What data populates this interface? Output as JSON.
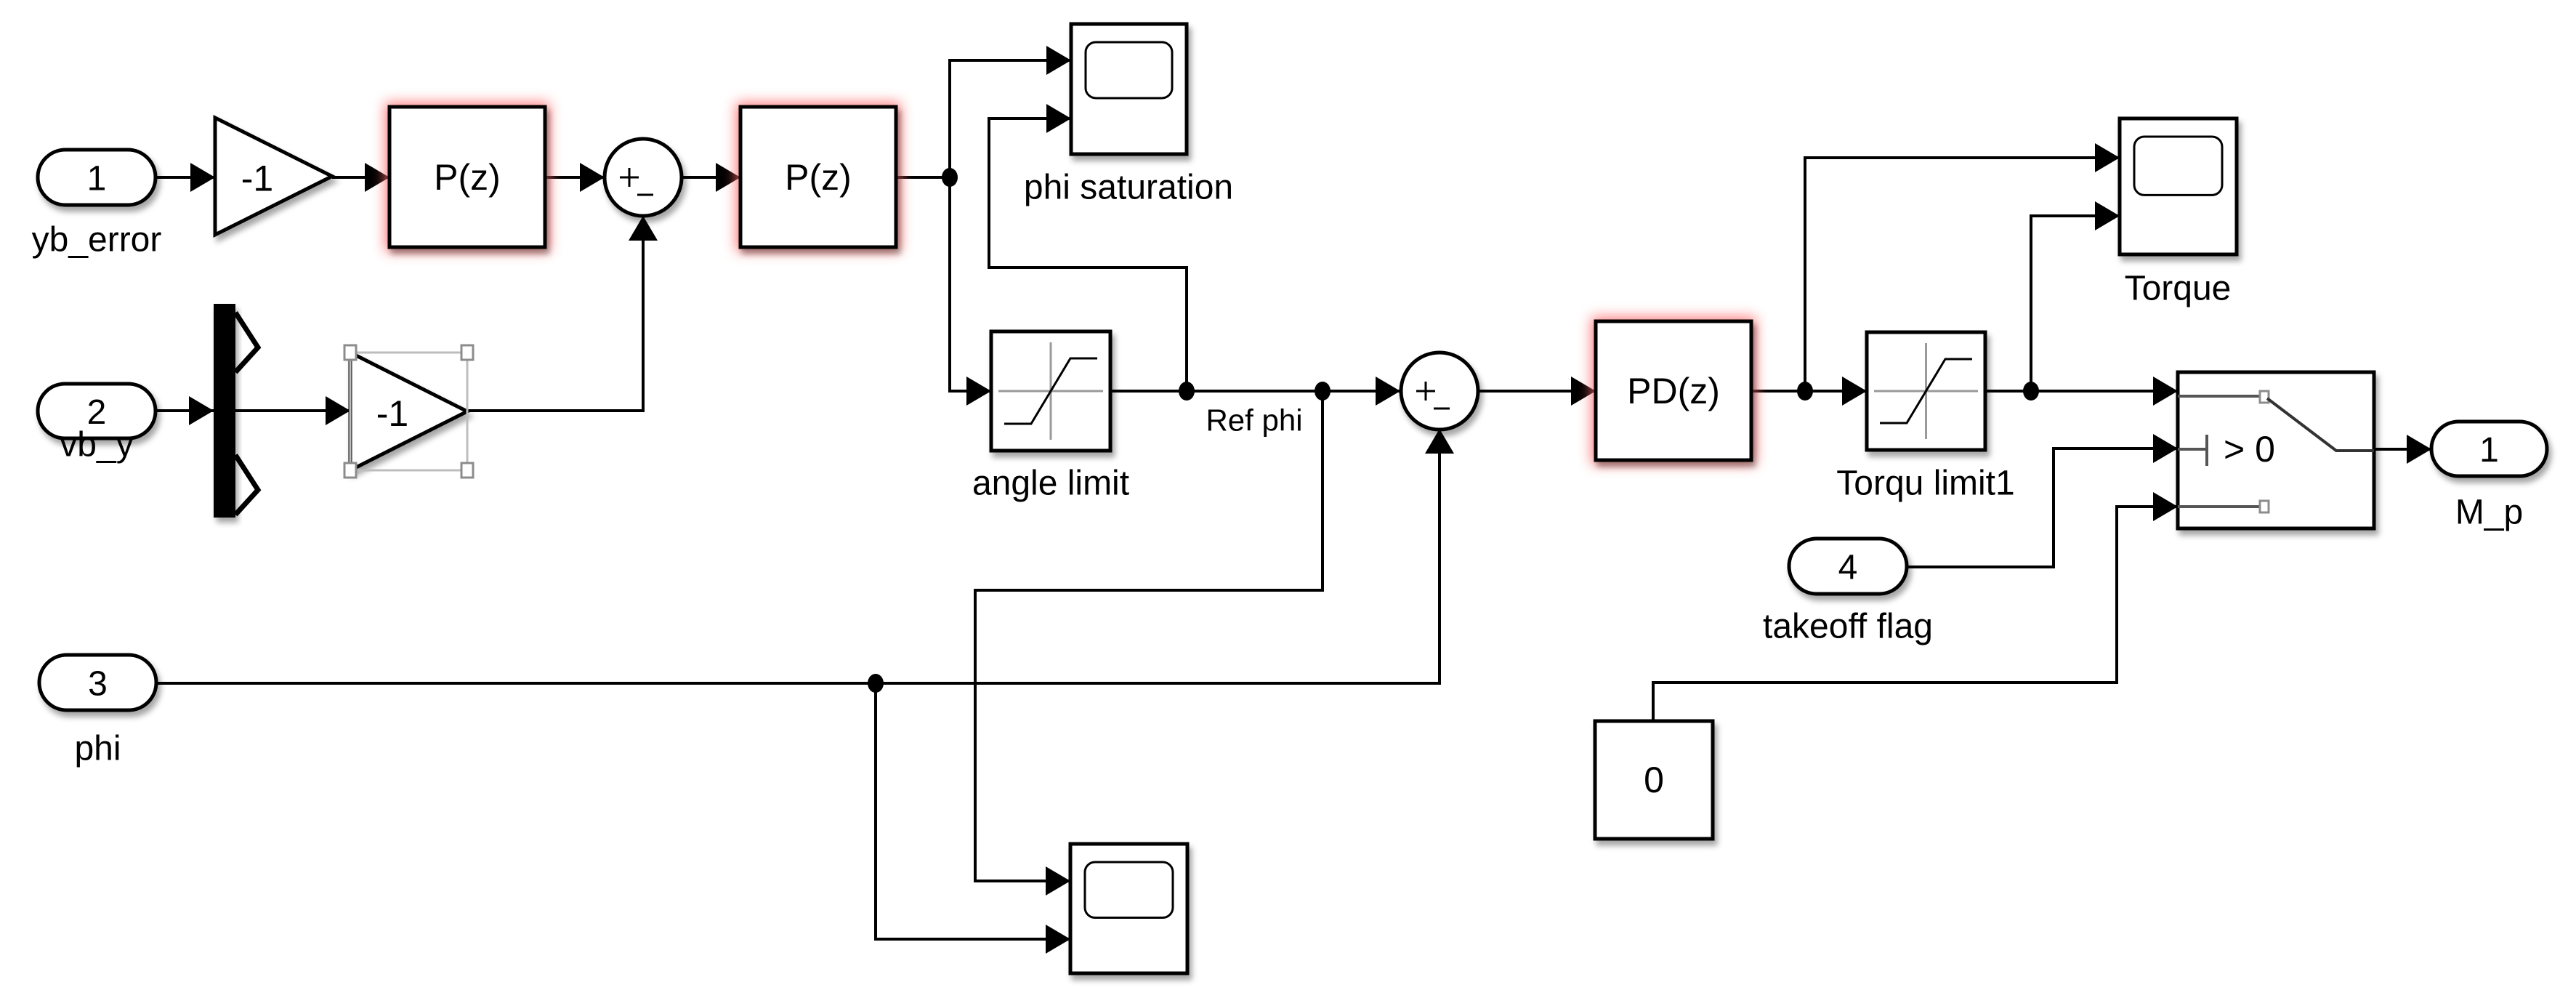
{
  "diagram": {
    "type": "simulink-block-diagram",
    "accent_colors": {
      "highlight_glow": "#ff6b6b",
      "wire": "#000000",
      "selection": "#9a9a9a"
    },
    "inports": [
      {
        "id": "in1",
        "number": "1",
        "label": "yb_error"
      },
      {
        "id": "in2",
        "number": "2",
        "label": "vb_y"
      },
      {
        "id": "in3",
        "number": "3",
        "label": "phi"
      },
      {
        "id": "in4",
        "number": "4",
        "label": "takeoff flag"
      }
    ],
    "outports": [
      {
        "id": "out1",
        "number": "1",
        "label": "M_p"
      }
    ],
    "gains": [
      {
        "id": "gain1",
        "value": "-1",
        "selected": false
      },
      {
        "id": "gain2",
        "value": "-1",
        "selected": true
      }
    ],
    "transfer_blocks": [
      {
        "id": "pz1",
        "text": "P(z)",
        "highlighted": true
      },
      {
        "id": "pz2",
        "text": "P(z)",
        "highlighted": true
      },
      {
        "id": "pdz",
        "text": "PD(z)",
        "highlighted": true
      }
    ],
    "sums": [
      {
        "id": "sum1",
        "signs": "+-"
      },
      {
        "id": "sum2",
        "signs": "+-"
      }
    ],
    "saturations": [
      {
        "id": "sat1",
        "label": "angle limit"
      },
      {
        "id": "sat2",
        "label": "Torqu limit1"
      }
    ],
    "scopes": [
      {
        "id": "scope1",
        "label": "phi saturation"
      },
      {
        "id": "scope2",
        "label": "Torque"
      },
      {
        "id": "scope3",
        "label": ""
      }
    ],
    "switch": {
      "id": "switch1",
      "criterion": "> 0"
    },
    "constant": {
      "id": "const1",
      "value": "0"
    },
    "demux": {
      "id": "demux1"
    },
    "signal_labels": [
      {
        "id": "refphi",
        "text": "Ref phi"
      }
    ]
  }
}
